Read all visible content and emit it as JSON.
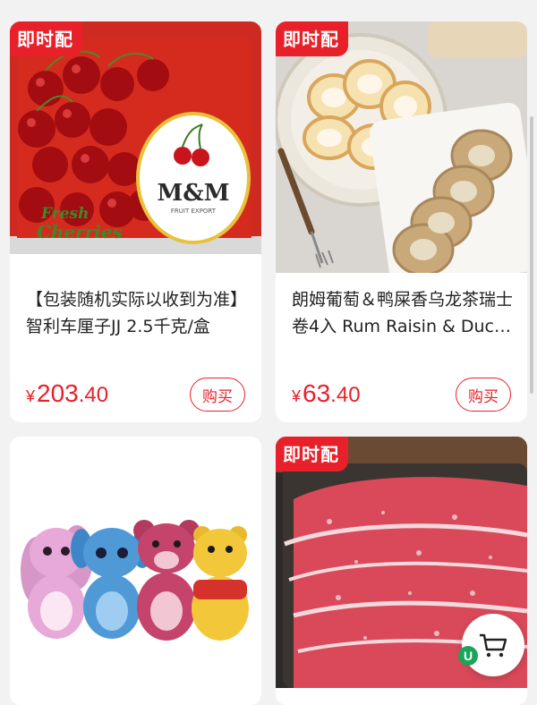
{
  "products": [
    {
      "tag": "即时配",
      "title": "【包装随机实际以收到为准】智利车厘子JJ 2.5千克/盒",
      "price_symbol": "¥",
      "price_int": "203",
      "price_dec": ".40",
      "buy_label": "购买",
      "box_brand": "M&M",
      "box_sub": "FRUIT EXPORT",
      "box_label_1": "Fresh",
      "box_label_2": "Cherries"
    },
    {
      "tag": "即时配",
      "title": "朗姆葡萄＆鸭屎香乌龙茶瑞士卷4入 Rum Raisin & Duck Shit Oolong Tea Swiss Roll",
      "price_symbol": "¥",
      "price_int": "63",
      "price_dec": ".40",
      "buy_label": "购买"
    },
    {
      "tag": ""
    },
    {
      "tag": "即时配"
    }
  ],
  "colors": {
    "accent": "#e8202a",
    "card_bg": "#ffffff",
    "page_bg": "#f2f2f2"
  }
}
